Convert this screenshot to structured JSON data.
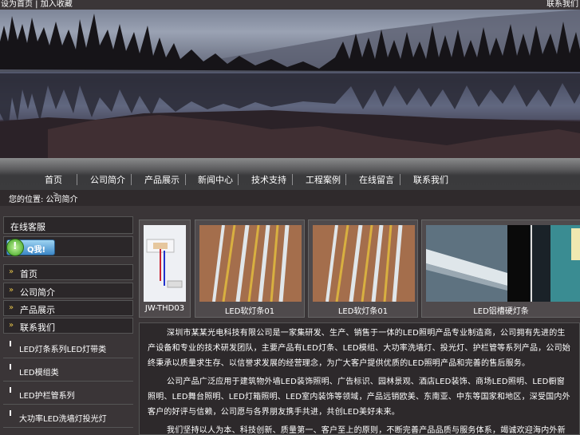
{
  "topbar": {
    "left_links": "设为首页 | 加入收藏",
    "right_link": "联系我们"
  },
  "nav": {
    "items": [
      {
        "label": "首页"
      },
      {
        "label": "公司简介"
      },
      {
        "label": "产品展示"
      },
      {
        "label": "新闻中心"
      },
      {
        "label": "技术支持"
      },
      {
        "label": "工程案例"
      },
      {
        "label": "在线留言"
      },
      {
        "label": "联系我们"
      }
    ]
  },
  "breadcrumb": {
    "text": "您的位置: 公司简介",
    "arrow": ">"
  },
  "sidebar": {
    "title": "在线客服",
    "qq_label": "Q我!",
    "menu": [
      {
        "label": "首页"
      },
      {
        "label": "公司简介"
      },
      {
        "label": "产品展示"
      },
      {
        "label": "联系我们"
      }
    ],
    "categories": [
      {
        "label": "LED灯条系列LED灯带类"
      },
      {
        "label": "LED模组类"
      },
      {
        "label": "LED护栏管系列"
      },
      {
        "label": "大功率LED洗墙灯投光灯"
      }
    ]
  },
  "products": [
    {
      "caption": "JW-THD03",
      "image": "power-adapter-image"
    },
    {
      "caption": "LED软灯条01",
      "image": "led-strip-image"
    },
    {
      "caption": "LED软灯条01",
      "image": "led-strip-image"
    },
    {
      "caption": "LED铝槽硬灯条",
      "image": "led-aluminum-bar-image"
    }
  ],
  "article": {
    "paragraphs": [
      "深圳市某某光电科技有限公司是一家集研发、生产、销售于一体的LED照明产品专业制造商，公司拥有先进的生产设备和专业的技术研发团队，主要产品有LED灯条、LED模组、大功率洗墙灯、投光灯、护栏管等系列产品，公司始终秉承以质量求生存、以信誉求发展的经营理念，为广大客户提供优质的LED照明产品和完善的售后服务。",
      "公司产品广泛应用于建筑物外墙LED装饰照明、广告标识、园林景观、酒店LED装饰、商场LED照明、LED橱窗照明、LED舞台照明、LED灯箱照明、LED室内装饰等领域，产品远销欧美、东南亚、中东等国家和地区，深受国内外客户的好评与信赖，公司愿与各界朋友携手共进，共创LED美好未来。",
      "我们坚持以人为本、科技创新、质量第一、客户至上的原则，不断完善产品品质与服务体系，竭诚欢迎海内外新老客户来电来函洽谈合作，我们将以最优质的产品、最合理的价格、最完善的服务回报每一位客户，期待与您的合作。"
    ]
  },
  "colors": {
    "background": "#3a3537",
    "bullet": "#e5c34a",
    "qq_button": "#3d88c8"
  }
}
